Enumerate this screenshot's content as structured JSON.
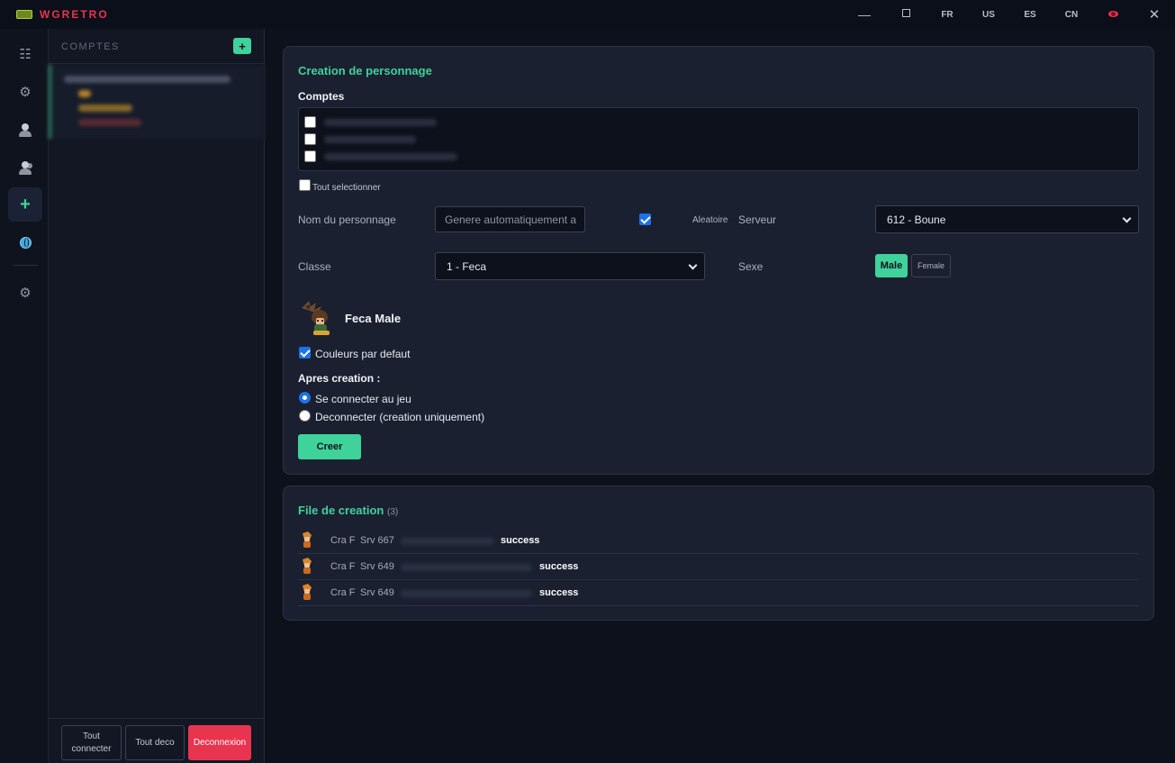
{
  "app": {
    "title": "WGRETRO"
  },
  "window": {
    "languages": [
      "FR",
      "US",
      "ES",
      "CN"
    ]
  },
  "sidebar": {
    "accounts_title": "COMPTES",
    "add_label": "+"
  },
  "footer": {
    "connect_all": "Tout connecter",
    "disconnect_all": "Tout deco",
    "logout": "Deconnexion"
  },
  "creation": {
    "title": "Creation de personnage",
    "accounts_label": "Comptes",
    "select_all": "Tout selectionner",
    "name_label": "Nom du personnage",
    "name_placeholder": "Genere automatiquement a",
    "random_label": "Aleatoire",
    "server_label": "Serveur",
    "server_value": "612 - Boune",
    "class_label": "Classe",
    "class_value": "1 - Feca",
    "sex_label": "Sexe",
    "sex_male": "Male",
    "sex_female": "Female",
    "preview_name": "Feca Male",
    "default_colors": "Couleurs par defaut",
    "after_label": "Apres creation :",
    "option_connect": "Se connecter au jeu",
    "option_disconnect": "Deconnecter (creation uniquement)",
    "create_button": "Creer"
  },
  "queue": {
    "title": "File de creation",
    "count": "(3)",
    "rows": [
      {
        "class": "Cra F",
        "server": "Srv 667",
        "status": "success"
      },
      {
        "class": "Cra F",
        "server": "Srv 649",
        "status": "success"
      },
      {
        "class": "Cra F",
        "server": "Srv 649",
        "status": "success"
      }
    ]
  },
  "colors": {
    "accent": "#3fd29a",
    "danger": "#e8344f",
    "background": "#0d111c",
    "card": "#1b2030"
  }
}
